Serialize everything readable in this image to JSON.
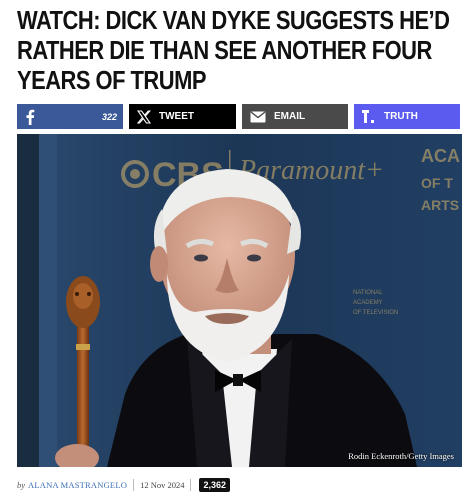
{
  "article": {
    "headline": "WATCH: DICK VAN DYKE SUGGESTS HE’D RATHER DIE THAN SEE ANOTHER FOUR YEARS OF TRUMP"
  },
  "share": {
    "facebook": {
      "icon": "facebook-icon",
      "count": "322",
      "color": "#3b5998"
    },
    "twitter": {
      "icon": "x-icon",
      "label": "TWEET",
      "color": "#000000"
    },
    "email": {
      "icon": "envelope-icon",
      "label": "EMAIL",
      "color": "#4a4a4a"
    },
    "truth": {
      "icon": "truth-social-icon",
      "label": "TRUTH",
      "color": "#5b5bf0"
    }
  },
  "image": {
    "backdrop_logos": [
      "CBS",
      "Paramount+"
    ],
    "backdrop_text": "ACA OF T ARTS",
    "credit": "Rodin Eckenroth/Getty Images"
  },
  "byline": {
    "by": "by",
    "author": "ALANA MASTRANGELO",
    "date": "12 Nov 2024",
    "comments": "2,362"
  }
}
